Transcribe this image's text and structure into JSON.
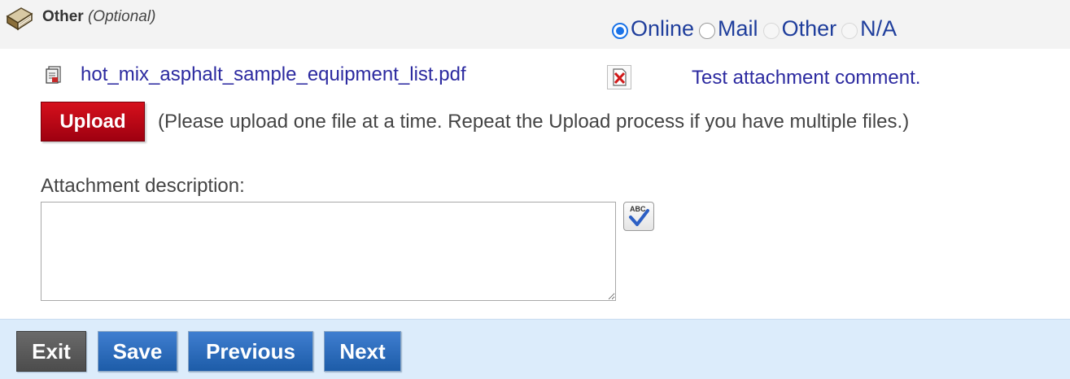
{
  "section": {
    "title": "Other",
    "optional_label": "(Optional)",
    "delivery_options": [
      {
        "label": "Online",
        "selected": true,
        "enabled": true
      },
      {
        "label": "Mail",
        "selected": false,
        "enabled": true
      },
      {
        "label": "Other",
        "selected": false,
        "enabled": false
      },
      {
        "label": "N/A",
        "selected": false,
        "enabled": false
      }
    ]
  },
  "attachment": {
    "file_name": "hot_mix_asphalt_sample_equipment_list.pdf",
    "comment": "Test attachment comment.",
    "file_icon": "pdf-file-icon",
    "delete_icon": "delete-file-icon"
  },
  "upload": {
    "button_label": "Upload",
    "hint": "(Please upload one file at a time. Repeat the Upload process if you have multiple files.)"
  },
  "description": {
    "label": "Attachment description:",
    "value": "",
    "spellcheck_icon": "spellcheck-icon"
  },
  "footer": {
    "exit_label": "Exit",
    "save_label": "Save",
    "previous_label": "Previous",
    "next_label": "Next"
  },
  "colors": {
    "link": "#2c2aa0",
    "upload_red": "#c30014",
    "nav_blue": "#2a6bbd",
    "footer_bg": "#dcecfb",
    "header_bg": "#f3f3f3"
  }
}
